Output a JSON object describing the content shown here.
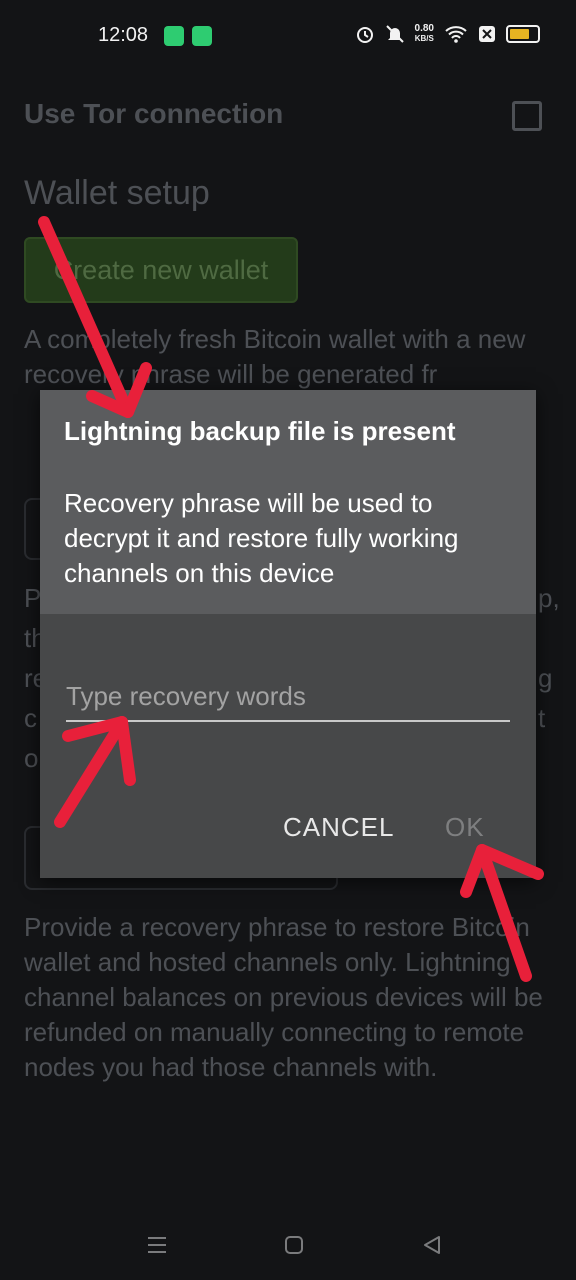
{
  "status_bar": {
    "time": "12:08",
    "speed_value": "0.80",
    "speed_unit": "KB/S",
    "icons": [
      "app-notification-icon",
      "shield-app-icon",
      "alarm-icon",
      "mute-icon",
      "wifi-icon",
      "close-box-icon",
      "battery-icon"
    ]
  },
  "settings": {
    "tor_label": "Use Tor connection",
    "section_title": "Wallet setup",
    "create_button": "Create new wallet",
    "create_description": "A completely fresh Bitcoin wallet with a new recovery phrase will be generated fr",
    "restore_description": "Provide a recovery phrase to restore Bitcoin wallet and hosted channels only. Lightning channel balances on previous devices will be refunded on manually connecting to remote nodes you had those channels with.",
    "clipped_left": [
      "P",
      "th",
      "re",
      "c",
      "o"
    ],
    "clipped_right": [
      "p,",
      "g",
      "t"
    ]
  },
  "dialog": {
    "title": "Lightning backup file is present",
    "message": "Recovery phrase will be used to decrypt it and restore fully working channels on this device",
    "input_placeholder": "Type recovery words",
    "cancel_label": "CANCEL",
    "ok_label": "OK"
  },
  "nav_bar": {
    "icons": [
      "menu-icon",
      "home-icon",
      "back-icon"
    ]
  },
  "colors": {
    "background": "#131416",
    "dialog": "#474849",
    "dialog_header": "#5b5c5e",
    "annotation_arrow": "#e8203a"
  }
}
